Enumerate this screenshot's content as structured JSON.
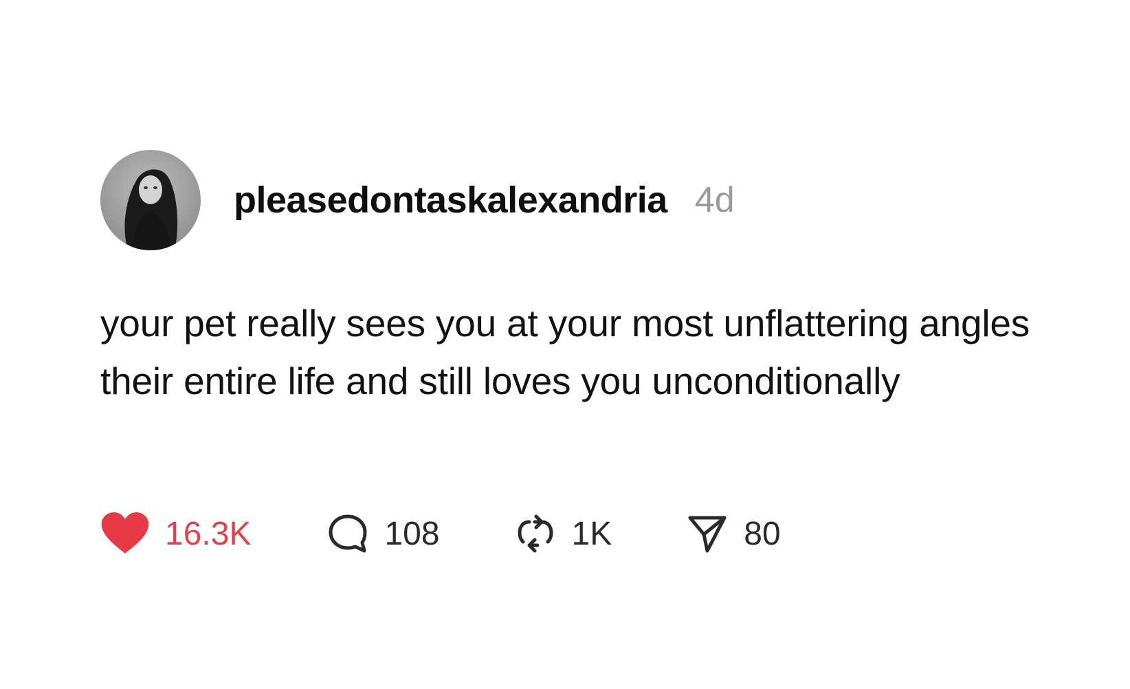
{
  "post": {
    "username": "pleasedontaskalexandria",
    "time_ago": "4d",
    "text": "your pet really sees you at your most unflattering angles their entire life and still loves you unconditionally"
  },
  "actions": {
    "likes": "16.3K",
    "replies": "108",
    "reposts": "1K",
    "shares": "80"
  },
  "icons": {
    "like": "heart-icon",
    "reply": "comment-bubble-icon",
    "repost": "repost-arrows-icon",
    "share": "send-paper-plane-icon"
  },
  "colors": {
    "like_red": "#e63946",
    "time_gray": "#9a9a9a",
    "text_dark": "#121212"
  }
}
